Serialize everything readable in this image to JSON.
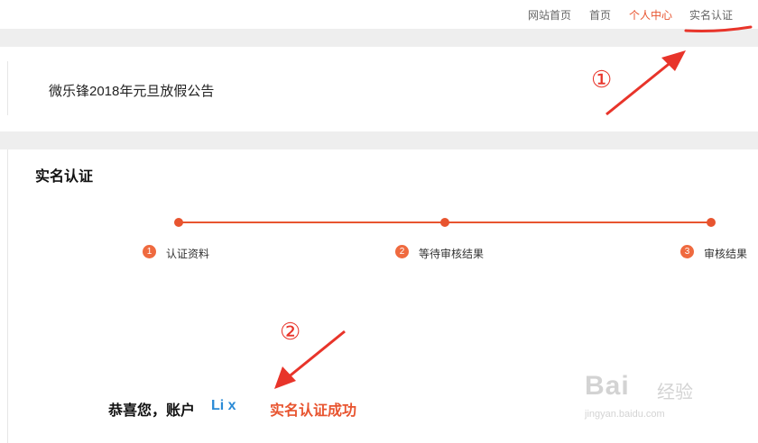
{
  "topnav": {
    "links": [
      {
        "label": "网站首页"
      },
      {
        "label": "首页"
      },
      {
        "label": "个人中心"
      },
      {
        "label": "实名认证"
      }
    ]
  },
  "notice": {
    "title": "微乐锋2018年元旦放假公告"
  },
  "verification": {
    "title": "实名认证",
    "steps": [
      {
        "num": "1",
        "label": "认证资料"
      },
      {
        "num": "2",
        "label": "等待审核结果"
      },
      {
        "num": "3",
        "label": "审核结果"
      }
    ],
    "result": {
      "prefix": "恭喜您，账户",
      "account": "Li    x",
      "status": "实名认证成功"
    }
  },
  "annotations": {
    "marker1": "①",
    "marker2": "②"
  },
  "watermark": {
    "brand": "Bai",
    "sub": "经验",
    "url": "jingyan.baidu.com"
  },
  "colors": {
    "accent": "#e8542f",
    "annotation": "#e8342a",
    "account": "#2a8ad6"
  }
}
